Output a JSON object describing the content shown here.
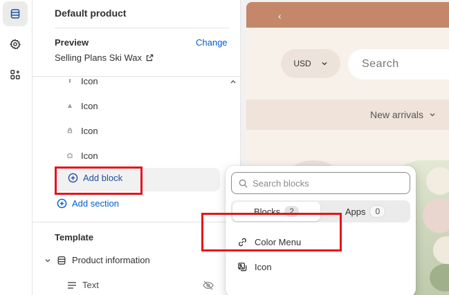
{
  "sidebar": {
    "title": "Default product",
    "preview_label": "Preview",
    "change_label": "Change",
    "preview_product": "Selling Plans Ski Wax",
    "icon_rows": [
      "Icon",
      "Icon",
      "Icon",
      "Icon"
    ],
    "add_block_label": "Add block",
    "add_section_label": "Add section",
    "template_label": "Template",
    "product_info_label": "Product information",
    "text_item_label": "Text"
  },
  "preview": {
    "currency": "USD",
    "search_placeholder": "Search",
    "nav_item": "New arrivals",
    "back_glyph": "‹"
  },
  "popover": {
    "search_placeholder": "Search blocks",
    "tabs": [
      {
        "label": "Blocks",
        "count": "2"
      },
      {
        "label": "Apps",
        "count": "0"
      }
    ],
    "items": [
      {
        "label": "Color Menu",
        "icon": "link-icon"
      },
      {
        "label": "Icon",
        "icon": "image-icon"
      }
    ]
  },
  "colors": {
    "highlight": "#e8111a",
    "link_blue": "#005bd3",
    "topbar": "#c4876a",
    "store_bg": "#f8f1ea"
  }
}
